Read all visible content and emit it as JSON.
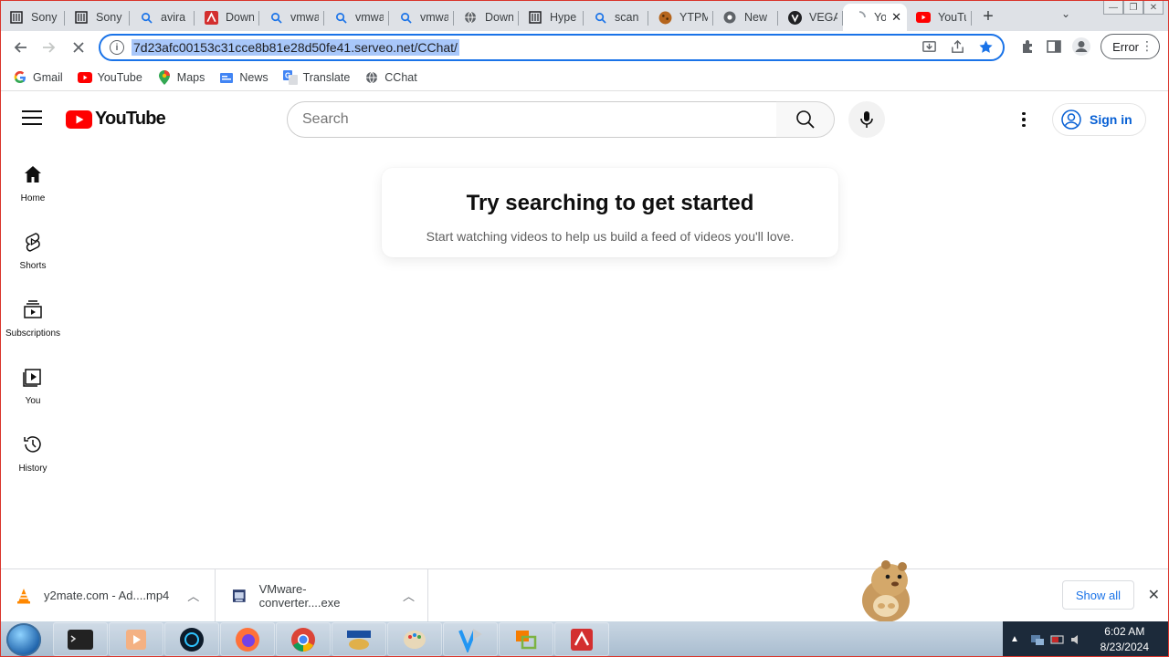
{
  "browser": {
    "tabs": [
      {
        "title": "Sony",
        "icon": "document-icon"
      },
      {
        "title": "Sony",
        "icon": "document-icon"
      },
      {
        "title": "avira",
        "icon": "search-icon"
      },
      {
        "title": "Down",
        "icon": "avira-icon"
      },
      {
        "title": "vmwa",
        "icon": "search-icon"
      },
      {
        "title": "vmwa",
        "icon": "search-icon"
      },
      {
        "title": "vmwa",
        "icon": "search-icon"
      },
      {
        "title": "Down",
        "icon": "globe-icon"
      },
      {
        "title": "Hype",
        "icon": "document-icon"
      },
      {
        "title": "scan",
        "icon": "search-icon"
      },
      {
        "title": "YTPM",
        "icon": "cookie-icon"
      },
      {
        "title": "New",
        "icon": "chrome-icon"
      },
      {
        "title": "VEGA",
        "icon": "vega-icon"
      },
      {
        "title": "Yo",
        "icon": "loading-icon",
        "active": true
      },
      {
        "title": "YouTu",
        "icon": "youtube-icon"
      }
    ],
    "new_tab": "+",
    "tab_search": "⌄",
    "url": "7d23afc00153c31cce8b81e28d50fe41.serveo.net/CChat/",
    "profile_error": "Error",
    "bookmarks": [
      {
        "label": "Gmail",
        "icon": "google-icon"
      },
      {
        "label": "YouTube",
        "icon": "youtube-icon"
      },
      {
        "label": "Maps",
        "icon": "maps-icon"
      },
      {
        "label": "News",
        "icon": "news-icon"
      },
      {
        "label": "Translate",
        "icon": "translate-icon"
      },
      {
        "label": "CChat",
        "icon": "globe-icon"
      }
    ]
  },
  "youtube": {
    "logo": "YouTube",
    "search_placeholder": "Search",
    "sign_in": "Sign in",
    "guide": [
      {
        "label": "Home",
        "icon": "home-icon"
      },
      {
        "label": "Shorts",
        "icon": "shorts-icon"
      },
      {
        "label": "Subscriptions",
        "icon": "subscriptions-icon"
      },
      {
        "label": "You",
        "icon": "you-icon"
      },
      {
        "label": "History",
        "icon": "history-icon"
      }
    ],
    "empty_title": "Try searching to get started",
    "empty_subtitle": "Start watching videos to help us build a feed of videos you'll love."
  },
  "downloads": {
    "items": [
      {
        "name": "y2mate.com - Ad....mp4",
        "icon": "vlc-icon"
      },
      {
        "name": "VMware-converter....exe",
        "icon": "installer-icon"
      }
    ],
    "show_all": "Show all"
  },
  "taskbar": {
    "time": "6:02 AM",
    "date": "8/23/2024"
  },
  "colors": {
    "youtube_red": "#ff0000",
    "link_blue": "#065fd4",
    "url_highlight": "#a8c7fa",
    "focus_ring": "#1a73e8"
  }
}
